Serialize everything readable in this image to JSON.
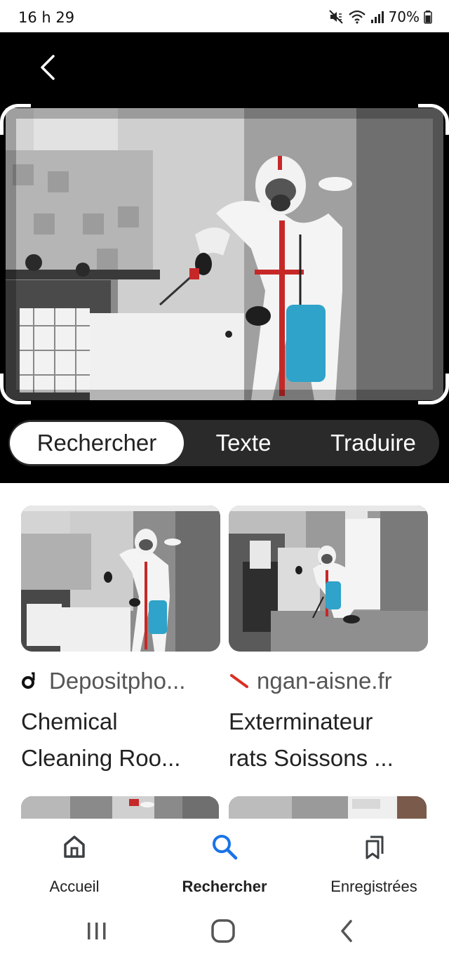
{
  "status_bar": {
    "time": "16 h 29",
    "battery": "70%"
  },
  "tabs": [
    {
      "label": "Rechercher",
      "active": true
    },
    {
      "label": "Texte",
      "active": false
    },
    {
      "label": "Traduire",
      "active": false
    }
  ],
  "results": [
    {
      "source": "Depositpho...",
      "source_icon": "depositphotos-logo-icon",
      "title_line1": "Chemical",
      "title_line2": "Cleaning Roo..."
    },
    {
      "source": "ngan-aisne.fr",
      "source_icon": "red-slash-favicon-icon",
      "title_line1": "Exterminateur",
      "title_line2": "rats Soissons ..."
    }
  ],
  "bottom_nav": [
    {
      "label": "Accueil",
      "icon": "home-icon",
      "active": false
    },
    {
      "label": "Rechercher",
      "icon": "search-icon",
      "active": true
    },
    {
      "label": "Enregistrées",
      "icon": "saved-icon",
      "active": false
    }
  ],
  "colors": {
    "accent": "#1a73e8",
    "source_red": "#d93025"
  }
}
